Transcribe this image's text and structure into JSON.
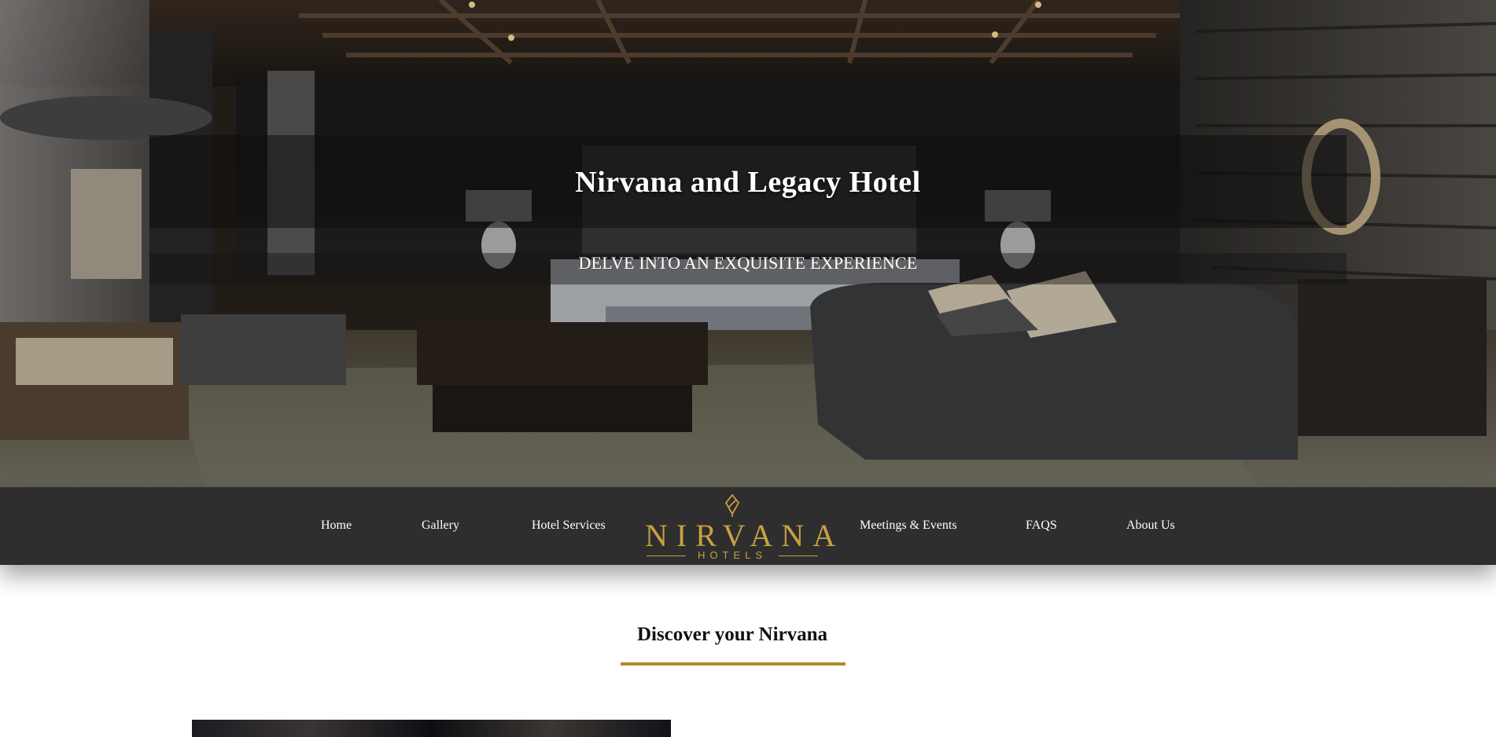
{
  "hero": {
    "title": "Nirvana and Legacy Hotel",
    "tagline": "DELVE INTO AN EXQUISITE EXPERIENCE"
  },
  "nav": {
    "items": [
      {
        "label": "Home"
      },
      {
        "label": "Gallery"
      },
      {
        "label": "Hotel Services"
      },
      {
        "label": "Meetings & Events"
      },
      {
        "label": "FAQS"
      },
      {
        "label": "About Us"
      }
    ]
  },
  "logo": {
    "word": "NIRVANA",
    "sub": "HOTELS"
  },
  "content": {
    "heading": "Discover your Nirvana"
  },
  "colors": {
    "nav_background": "#2e2e2e",
    "gold_accent": "#c9a043",
    "underline": "#b38a2e"
  }
}
